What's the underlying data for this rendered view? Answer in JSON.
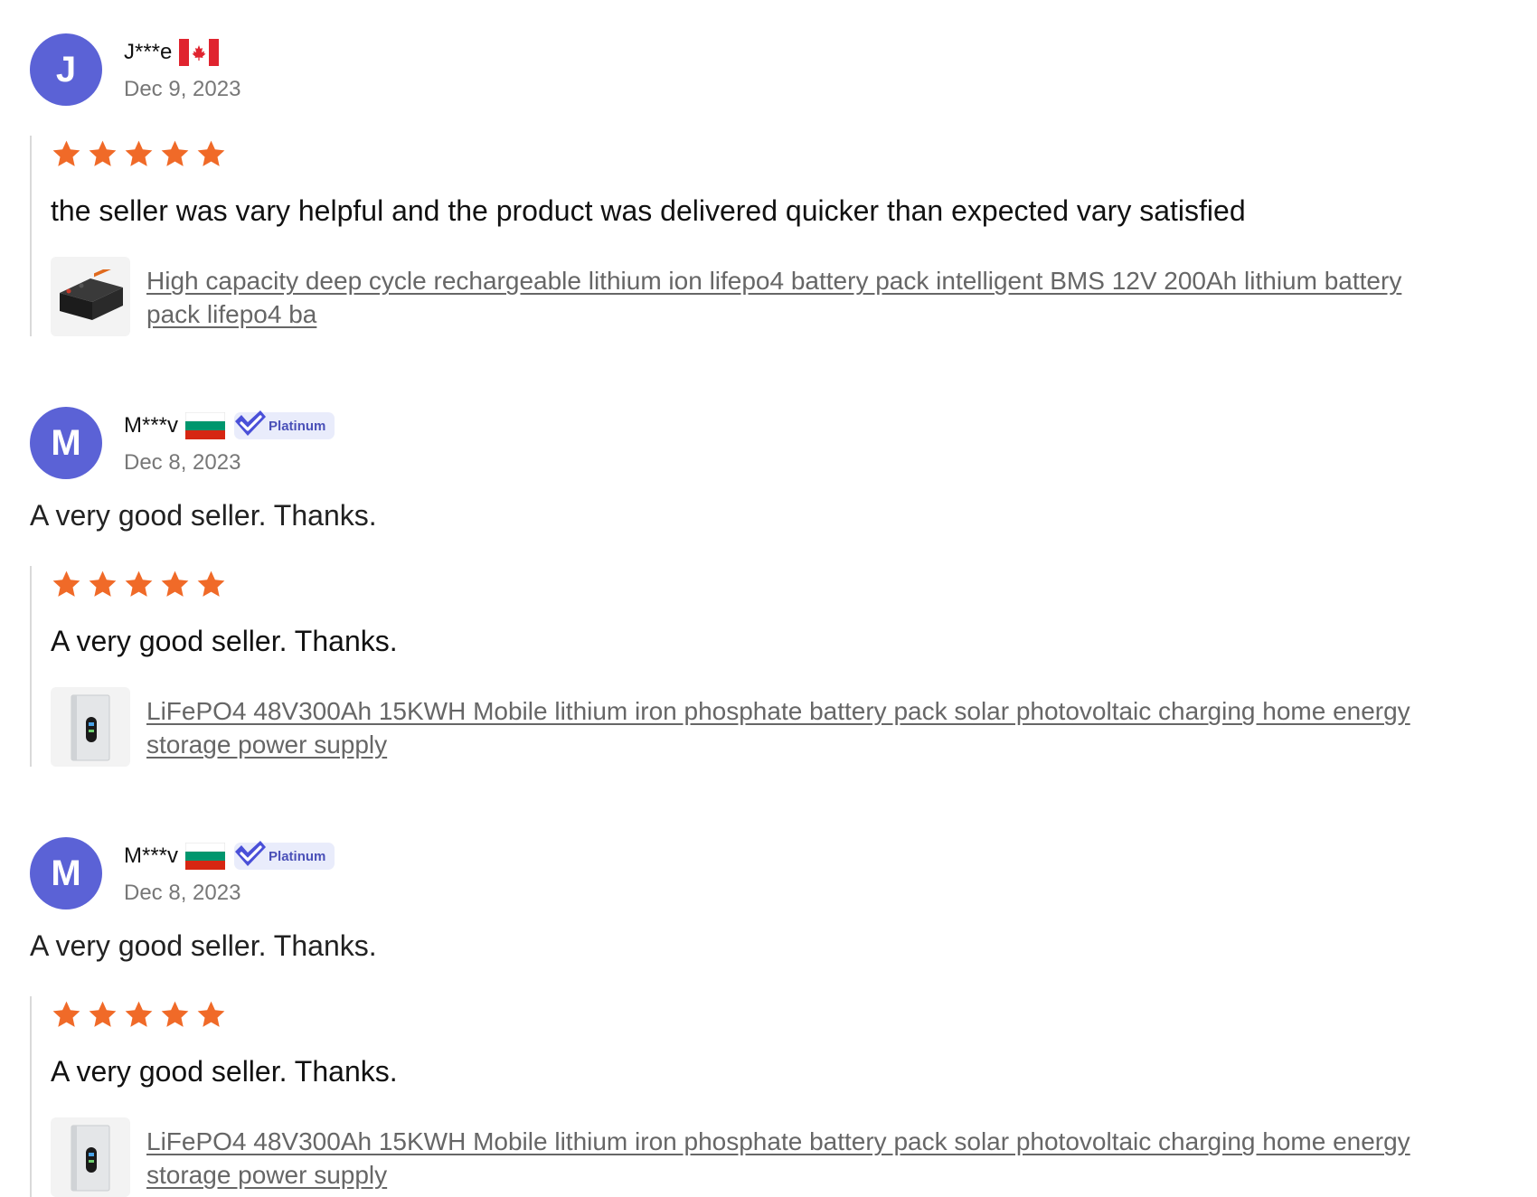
{
  "reviews": [
    {
      "avatar_initial": "J",
      "name": "J***e",
      "flag": "canada-flag",
      "date": "Dec 9, 2023",
      "summary": "",
      "stars": 5,
      "text": "the seller was vary helpful and the product was delivered quicker than expected vary satisfied",
      "product_title": "High capacity deep cycle rechargeable lithium ion lifepo4 battery pack intelligent BMS 12V 200Ah lithium battery pack lifepo4 ba",
      "thumb": "battery-12v-image"
    },
    {
      "avatar_initial": "M",
      "name": "M***v",
      "flag": "bulgaria-flag",
      "badge": "Platinum",
      "date": "Dec 8, 2023",
      "summary": "A very good seller. Thanks.",
      "stars": 5,
      "text": "A very good seller. Thanks.",
      "product_title": "LiFePO4 48V300Ah 15KWH Mobile lithium iron phosphate battery pack solar photovoltaic charging home energy storage power supply",
      "thumb": "battery-48v-image"
    },
    {
      "avatar_initial": "M",
      "name": "M***v",
      "flag": "bulgaria-flag",
      "badge": "Platinum",
      "date": "Dec 8, 2023",
      "summary": "A very good seller. Thanks.",
      "stars": 5,
      "text": "A very good seller. Thanks.",
      "product_title": "LiFePO4 48V300Ah 15KWH Mobile lithium iron phosphate battery pack solar photovoltaic charging home energy storage power supply",
      "thumb": "battery-48v-image"
    }
  ],
  "colors": {
    "avatar": "#5b62d6",
    "star": "#f06a28",
    "badge_bg": "#e9ecfb",
    "badge_text": "#4a50b8",
    "link": "#666666"
  }
}
